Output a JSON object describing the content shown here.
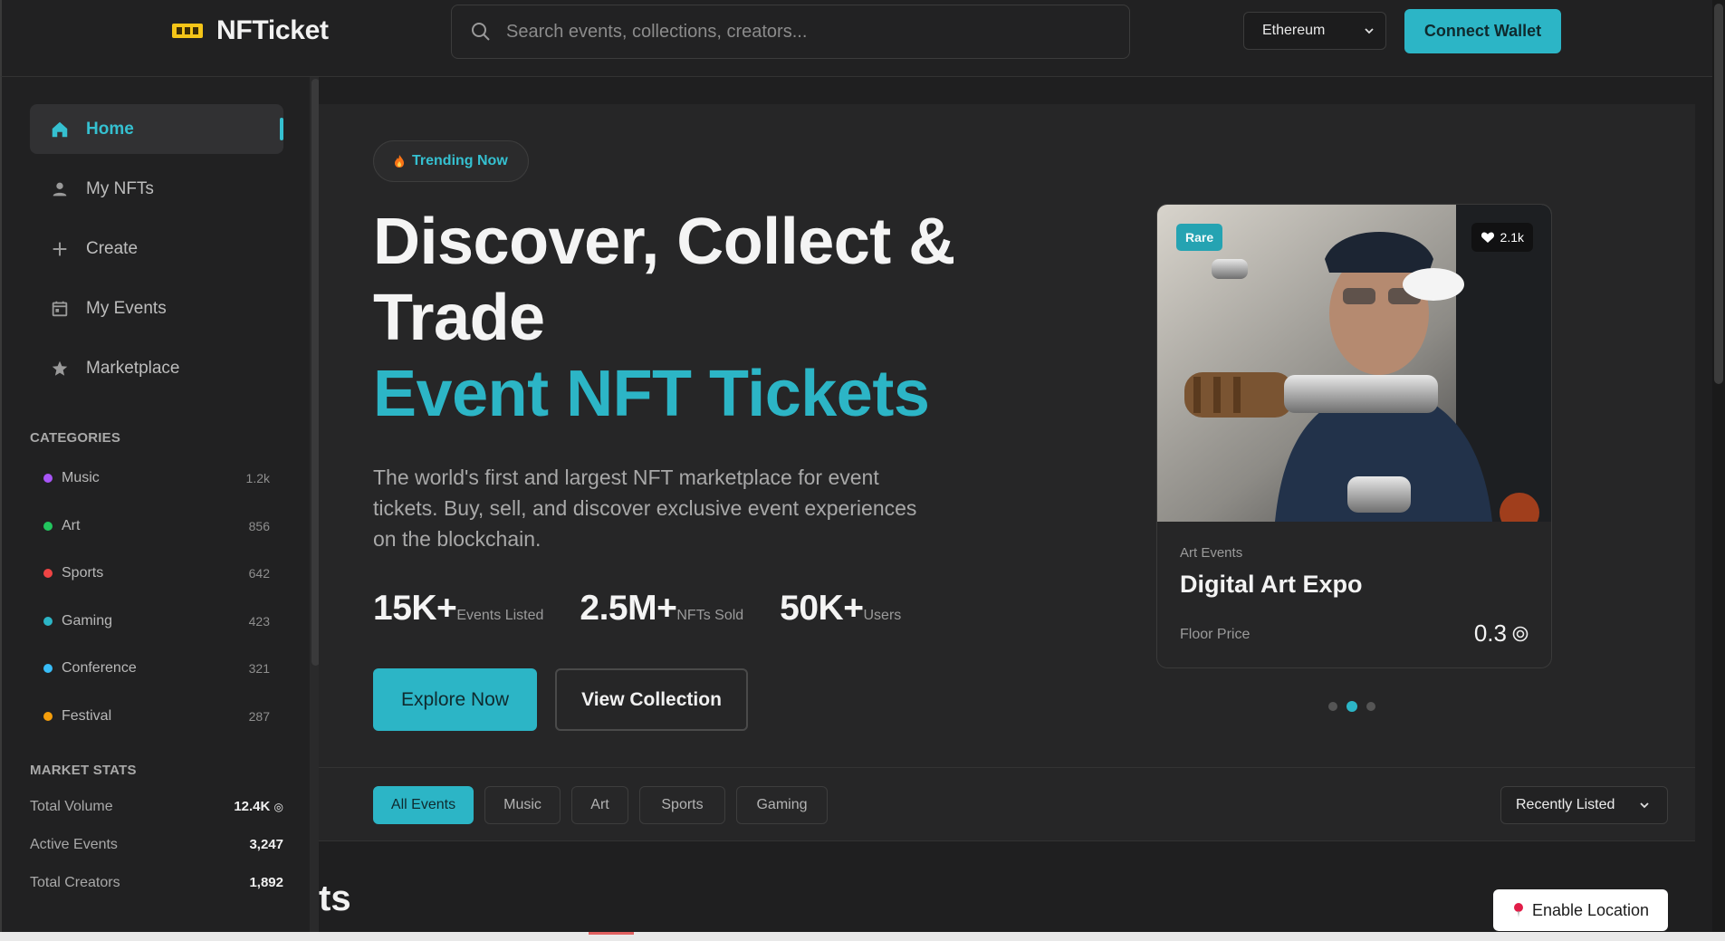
{
  "header": {
    "brand": "NFTicket",
    "search_placeholder": "Search events, collections, creators...",
    "network": "Ethereum",
    "connect_label": "Connect Wallet"
  },
  "sidebar": {
    "nav": [
      {
        "label": "Home",
        "icon": "home-icon",
        "active": true
      },
      {
        "label": "My NFTs",
        "icon": "user-icon"
      },
      {
        "label": "Create",
        "icon": "plus-icon"
      },
      {
        "label": "My Events",
        "icon": "calendar-icon"
      },
      {
        "label": "Marketplace",
        "icon": "star-icon"
      }
    ],
    "categories_title": "CATEGORIES",
    "categories": [
      {
        "label": "Music",
        "count": "1.2k",
        "color": "#a855f7"
      },
      {
        "label": "Art",
        "count": "856",
        "color": "#22c55e"
      },
      {
        "label": "Sports",
        "count": "642",
        "color": "#ef4444"
      },
      {
        "label": "Gaming",
        "count": "423",
        "color": "#2cb5c6"
      },
      {
        "label": "Conference",
        "count": "321",
        "color": "#38bdf8"
      },
      {
        "label": "Festival",
        "count": "287",
        "color": "#f59e0b"
      }
    ],
    "stats_title": "MARKET STATS",
    "stats": [
      {
        "label": "Total Volume",
        "value": "12.4K"
      },
      {
        "label": "Active Events",
        "value": "3,247"
      },
      {
        "label": "Total Creators",
        "value": "1,892"
      }
    ]
  },
  "hero": {
    "badge": "Trending Now",
    "title_line1": "Discover, Collect &",
    "title_line2": "Trade",
    "title_accent": "Event NFT Tickets",
    "description": "The world's first and largest NFT marketplace for event tickets. Buy, sell, and discover exclusive event experiences on the blockchain.",
    "kpis": [
      {
        "value": "15K+",
        "label": "Events Listed"
      },
      {
        "value": "2.5M+",
        "label": "NFTs Sold"
      },
      {
        "value": "50K+",
        "label": "Users"
      }
    ],
    "explore_label": "Explore Now",
    "collection_label": "View Collection"
  },
  "featured": {
    "tag": "Rare",
    "likes": "2.1k",
    "category": "Art Events",
    "title": "Digital Art Expo",
    "floor_label": "Floor Price",
    "floor_value": "0.3",
    "slides": 3,
    "active_slide": 2
  },
  "filters": {
    "chips": [
      "All Events",
      "Music",
      "Art",
      "Sports",
      "Gaming"
    ],
    "active": "All Events",
    "sort": "Recently Listed"
  },
  "section_heading_partial": "ts",
  "location_label": "Enable Location",
  "colors": {
    "accent": "#2cb5c6",
    "background": "#1f1f20",
    "panel": "#262627"
  }
}
